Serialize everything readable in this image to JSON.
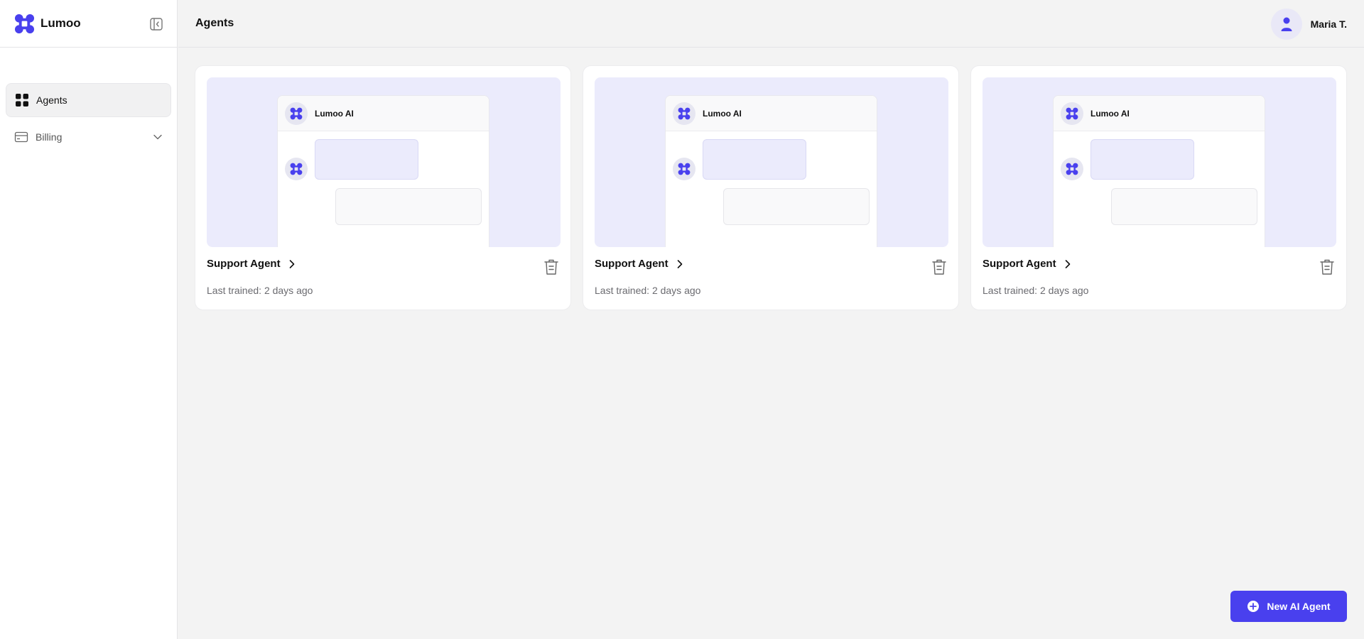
{
  "brand": {
    "name": "Lumoo",
    "accent": "#4940ee",
    "icon": "lumoo-logo-icon"
  },
  "sidebar": {
    "items": [
      {
        "label": "Agents",
        "icon": "grid-icon",
        "active": true
      },
      {
        "label": "Billing",
        "icon": "credit-card-icon",
        "active": false,
        "expandable": true
      }
    ]
  },
  "header": {
    "title": "Agents"
  },
  "user": {
    "name": "Maria T.",
    "icon": "user-icon"
  },
  "cards": [
    {
      "title": "Support Agent",
      "subtitle": "Last trained: 2 days ago",
      "preview_title": "Lumoo AI"
    },
    {
      "title": "Support Agent",
      "subtitle": "Last trained: 2 days ago",
      "preview_title": "Lumoo AI"
    },
    {
      "title": "Support Agent",
      "subtitle": "Last trained: 2 days ago",
      "preview_title": "Lumoo AI"
    }
  ],
  "actions": {
    "new_agent_label": "New AI Agent",
    "icon": "plus-circle-icon"
  }
}
